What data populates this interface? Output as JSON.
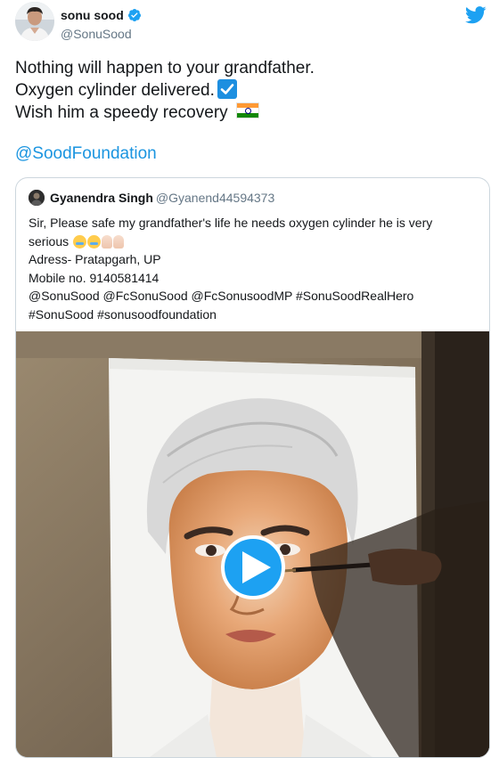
{
  "author": {
    "display_name": "sonu sood",
    "handle": "@SonuSood",
    "verified": true,
    "avatar_icon": "profile-photo"
  },
  "brand": {
    "logo_icon": "twitter-bird-icon",
    "color": "#1da1f2"
  },
  "tweet": {
    "line1": "Nothing will happen to your grandfather.",
    "line2": "Oxygen cylinder delivered.",
    "line3": "Wish him a speedy recovery ",
    "emoji_check": "check-mark-button-emoji",
    "emoji_flag": "india-flag-emoji",
    "mention": "@SoodFoundation",
    "link_color": "#1b95e0"
  },
  "quoted": {
    "display_name": "Gyanendra Singh",
    "handle": "@Gyanend44594373",
    "line1": "Sir, Please safe my grandfather's life he needs oxygen cylinder he is very",
    "line2": "serious ",
    "line3": "Adress- Pratapgarh, UP",
    "line4": "Mobile no. 9140581414",
    "line5": "@SonuSood @FcSonuSood @FcSonusoodMP #SonuSoodRealHero",
    "line6": "#SonuSood #sonusoodfoundation",
    "emojis": [
      "loudly-crying-face",
      "loudly-crying-face",
      "folded-hands",
      "folded-hands"
    ],
    "media": {
      "type": "video",
      "play_icon": "play-icon",
      "play_color": "#1da1f2",
      "content": "hand-painted portrait of a man"
    }
  }
}
